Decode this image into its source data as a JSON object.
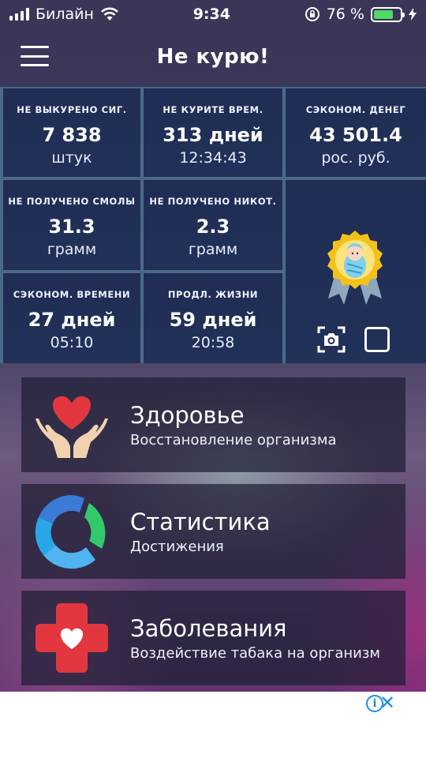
{
  "status_bar": {
    "carrier": "Билайн",
    "time": "9:34",
    "battery_percent": "76 %",
    "battery_level": 0.76
  },
  "header": {
    "title": "Не курю!",
    "menu_icon": "hamburger-menu-icon"
  },
  "stats": [
    {
      "label": "НЕ ВЫКУРЕНО СИГ.",
      "value": "7 838",
      "unit": "штук"
    },
    {
      "label": "НЕ КУРИТЕ ВРЕМ.",
      "value": "313 дней",
      "unit": "12:34:43"
    },
    {
      "label": "СЭКОНОМ. ДЕНЕГ",
      "value": "43 501.4",
      "unit": "рос. руб."
    },
    {
      "label": "НЕ ПОЛУЧЕНО СМОЛЫ",
      "value": "31.3",
      "unit": "грамм"
    },
    {
      "label": "НЕ ПОЛУЧЕНО НИКОТ.",
      "value": "2.3",
      "unit": "грамм"
    },
    {
      "label": "СЭКОНОМ. ВРЕМЕНИ",
      "value": "27 дней",
      "unit": "05:10"
    },
    {
      "label": "ПРОДЛ. ЖИЗНИ",
      "value": "59 дней",
      "unit": "20:58"
    }
  ],
  "badge": {
    "medal_icon": "baby-medal-icon",
    "camera_icon": "camera-screenshot-icon",
    "select_icon": "square-checkbox-icon"
  },
  "menu": [
    {
      "title": "Здоровье",
      "subtitle": "Восстановление организма",
      "icon": "heart-hands-icon"
    },
    {
      "title": "Статистика",
      "subtitle": "Достижения",
      "icon": "circular-chart-icon"
    },
    {
      "title": "Заболевания",
      "subtitle": "Воздействие табака на организм",
      "icon": "medical-cross-heart-icon"
    }
  ],
  "ad": {
    "info_glyph": "i",
    "close_glyph": "✕"
  },
  "colors": {
    "accent_blue": "#1a8fe0",
    "battery_green": "#4cd964",
    "heart_red": "#e2373f"
  }
}
